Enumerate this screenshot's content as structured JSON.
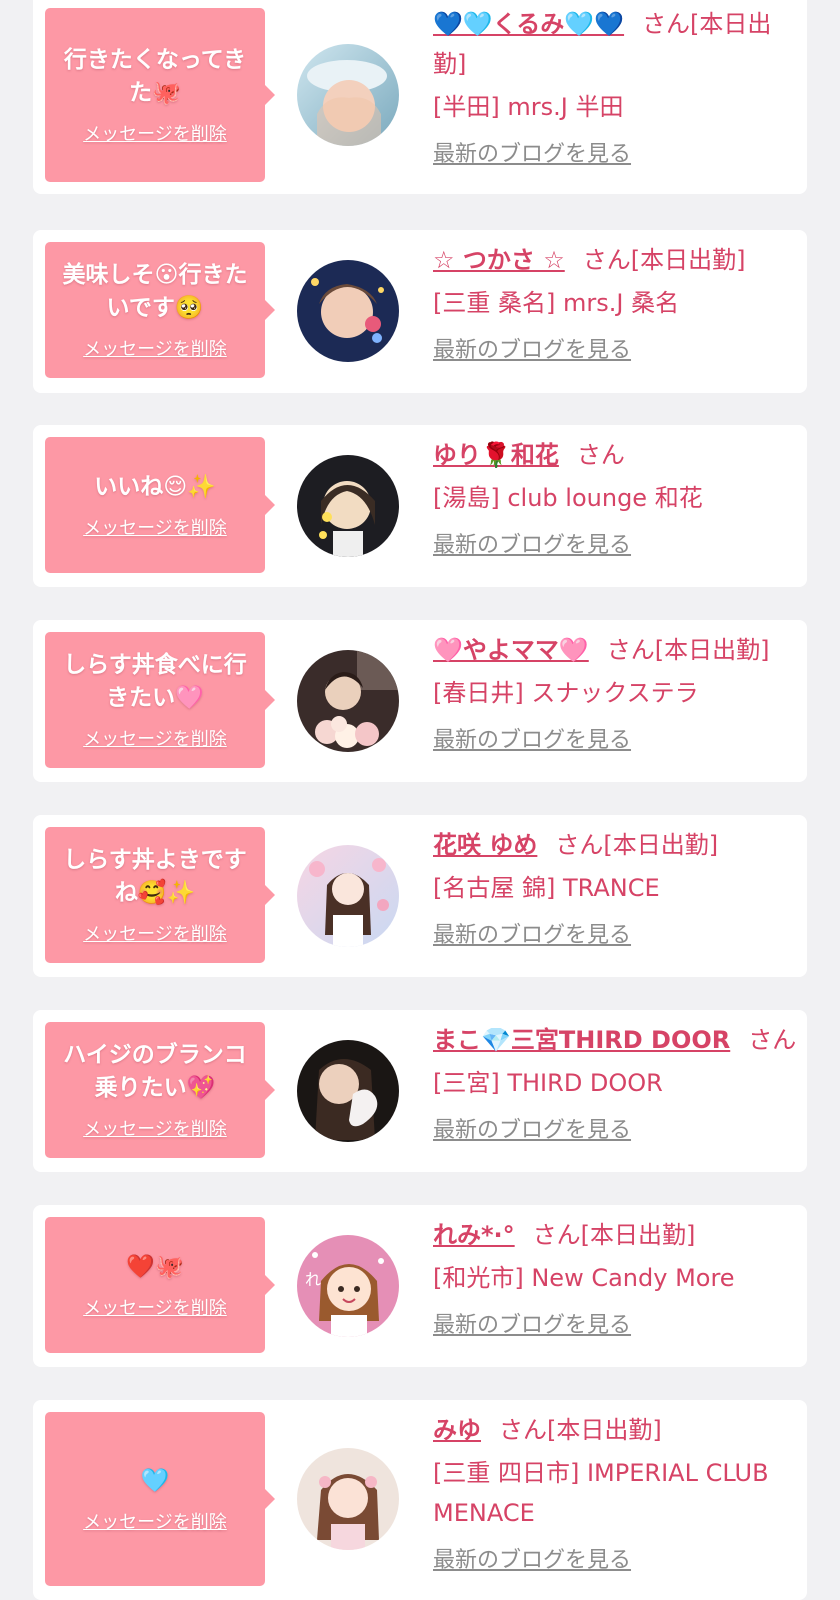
{
  "cards": [
    {
      "message": "行きたくなってきた🐙",
      "delete_label": "メッセージを削除",
      "name": "💙🩵くるみ🩵💙",
      "suffix": "さん[本日出勤]",
      "shop": "[半田] mrs.J 半田",
      "blog_label": "最新のブログを見る"
    },
    {
      "message": "美味しそ😮行きたいです🥺",
      "delete_label": "メッセージを削除",
      "name": "☆ つかさ ☆",
      "suffix": "さん[本日出勤]",
      "shop": "[三重 桑名] mrs.J 桑名",
      "blog_label": "最新のブログを見る"
    },
    {
      "message": "いいね😌✨",
      "delete_label": "メッセージを削除",
      "name": "ゆり🌹和花",
      "suffix": "さん",
      "shop": "[湯島] club lounge 和花",
      "blog_label": "最新のブログを見る"
    },
    {
      "message": "しらす丼食べに行きたい🩷",
      "delete_label": "メッセージを削除",
      "name": "🩷やよママ🩷",
      "suffix": "さん[本日出勤]",
      "shop": "[春日井] スナックステラ",
      "blog_label": "最新のブログを見る"
    },
    {
      "message": "しらす丼よきですね🥰✨",
      "delete_label": "メッセージを削除",
      "name": "花咲 ゆめ",
      "suffix": "さん[本日出勤]",
      "shop": "[名古屋 錦] TRANCE",
      "blog_label": "最新のブログを見る"
    },
    {
      "message": "ハイジのブランコ乗りたい💖",
      "delete_label": "メッセージを削除",
      "name": "まこ💎三宮THIRD DOOR",
      "suffix": "さん",
      "shop": "[三宮] THIRD DOOR",
      "blog_label": "最新のブログを見る"
    },
    {
      "message": "❤️🐙",
      "delete_label": "メッセージを削除",
      "name": "れみ*·°",
      "suffix": "さん[本日出勤]",
      "shop": "[和光市] New Candy More",
      "blog_label": "最新のブログを見る"
    },
    {
      "message": "🩵",
      "delete_label": "メッセージを削除",
      "name": "みゆ",
      "suffix": "さん[本日出勤]",
      "shop": "[三重 四日市] IMPERIAL CLUB MENACE",
      "blog_label": "最新のブログを見る"
    }
  ],
  "colors": {
    "page_bg": "#f1f1f3",
    "card_bg": "#ffffff",
    "bubble_bg": "#fd98a5",
    "accent": "#d64366",
    "blog_link": "#8c8c8c"
  }
}
